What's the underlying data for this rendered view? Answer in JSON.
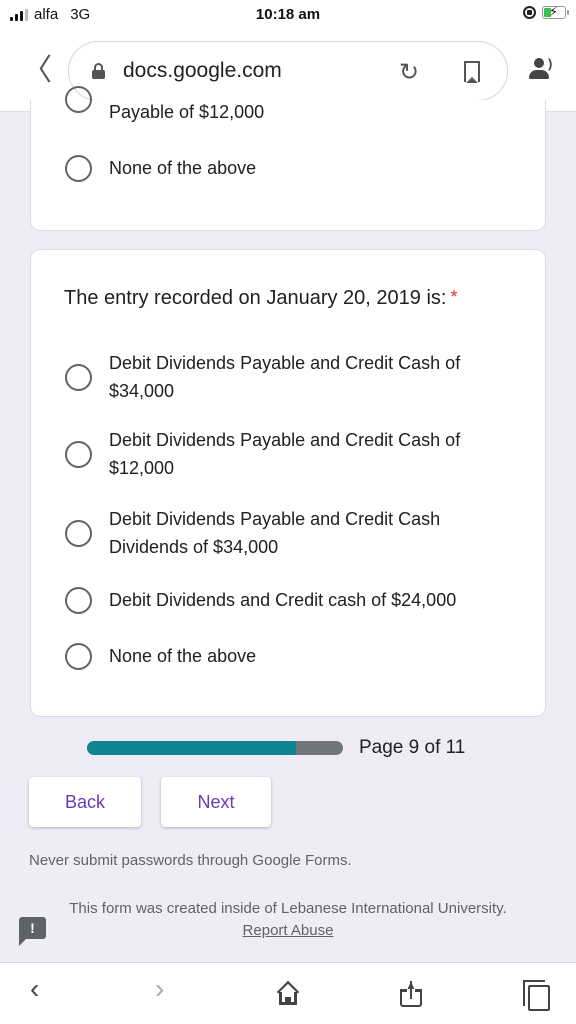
{
  "status_bar": {
    "carrier": "alfa",
    "network": "3G",
    "time": "10:18 am",
    "icons": [
      "signal-icon",
      "orientation-lock-icon",
      "battery-charging-icon"
    ],
    "battery_color": "#3bc14a"
  },
  "browser": {
    "url": "docs.google.com",
    "icons": [
      "back-icon",
      "lock-icon",
      "reload-icon",
      "bookmark-icon",
      "reader-voice-icon"
    ]
  },
  "previous_question": {
    "partial_option": "Payable of $12,000",
    "options": [
      {
        "label": "None of the above",
        "selected": false
      }
    ]
  },
  "question": {
    "title": "The entry recorded on January 20, 2019 is:",
    "required_mark": "*",
    "options": [
      {
        "label": "Debit Dividends Payable and Credit Cash of $34,000",
        "selected": false
      },
      {
        "label": "Debit Dividends Payable and Credit Cash of $12,000",
        "selected": false
      },
      {
        "label": "Debit Dividends Payable and Credit Cash Dividends of $34,000",
        "selected": false
      },
      {
        "label": "Debit Dividends and Credit cash of $24,000",
        "selected": false
      },
      {
        "label": "None of the above",
        "selected": false
      }
    ]
  },
  "progress": {
    "label": "Page 9 of 11",
    "current_page": 9,
    "total_pages": 11,
    "fill_fraction": 0.818,
    "fill_color": "#0f868f",
    "track_color": "#70757a"
  },
  "buttons": {
    "back": "Back",
    "next": "Next",
    "color": "#673ab7"
  },
  "footer": {
    "notice": "Never submit passwords through Google Forms.",
    "created_inside": "This form was created inside of Lebanese International University.",
    "report_abuse": "Report Abuse",
    "feedback_glyph": "!"
  },
  "bottom_toolbar": {
    "icons": [
      "back-icon",
      "forward-icon",
      "home-icon",
      "share-icon",
      "tabs-icon"
    ],
    "back_glyph": "‹",
    "forward_glyph": "›"
  }
}
